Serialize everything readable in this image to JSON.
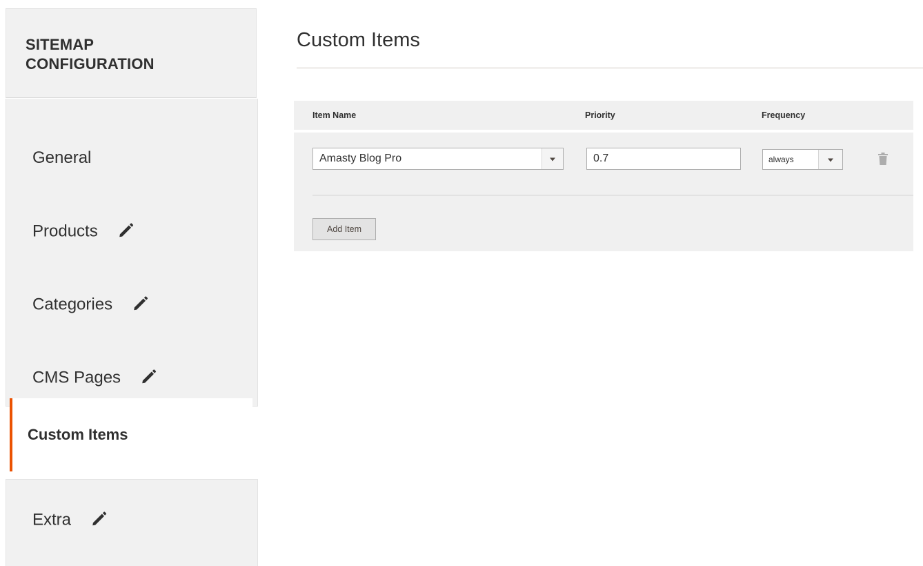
{
  "sidebar": {
    "title": "SITEMAP CONFIGURATION",
    "items": [
      {
        "label": "General",
        "edit_icon": false
      },
      {
        "label": "Products",
        "edit_icon": true
      },
      {
        "label": "Categories",
        "edit_icon": true
      },
      {
        "label": "CMS Pages",
        "edit_icon": true
      },
      {
        "label": "Custom Items",
        "active": true,
        "edit_icon": false
      },
      {
        "label": "Extra",
        "edit_icon": true
      }
    ],
    "active_accent": "#eb5202",
    "icon": "pencil-icon"
  },
  "main": {
    "title": "Custom Items",
    "grid": {
      "columns": [
        "Item Name",
        "Priority",
        "Frequency"
      ],
      "rows": [
        {
          "item_name": "Amasty Blog Pro",
          "priority": "0.7",
          "frequency": "always",
          "delete_icon": "trash-icon"
        }
      ],
      "add_label": "Add Item"
    }
  }
}
